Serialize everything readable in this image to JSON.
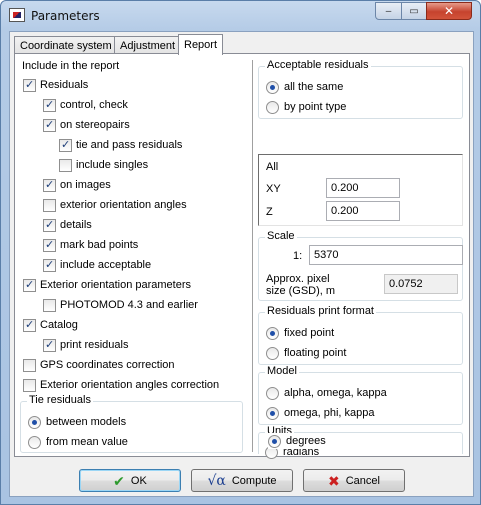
{
  "window": {
    "title": "Parameters",
    "buttons": {
      "minimize": "–",
      "maximize": "▭",
      "close": "✕"
    }
  },
  "tabs": [
    "Coordinate system",
    "Adjustment",
    "Report"
  ],
  "active_tab": "Report",
  "left": {
    "include_label": "Include in the report",
    "checks": [
      {
        "label": "Residuals",
        "checked": true
      },
      {
        "label": "control, check",
        "checked": true
      },
      {
        "label": "on stereopairs",
        "checked": true
      },
      {
        "label": "tie and pass residuals",
        "checked": true
      },
      {
        "label": "include singles",
        "checked": false
      },
      {
        "label": "on images",
        "checked": true
      },
      {
        "label": "exterior orientation angles",
        "checked": false
      },
      {
        "label": "details",
        "checked": true
      },
      {
        "label": "mark bad points",
        "checked": true
      },
      {
        "label": "include acceptable",
        "checked": true
      },
      {
        "label": "Exterior orientation parameters",
        "checked": true
      },
      {
        "label": "PHOTOMOD 4.3 and earlier",
        "checked": false
      },
      {
        "label": "Catalog",
        "checked": true
      },
      {
        "label": "print residuals",
        "checked": true
      },
      {
        "label": "GPS coordinates correction",
        "checked": false
      },
      {
        "label": "Exterior orientation angles correction",
        "checked": false
      }
    ],
    "tie_residuals": {
      "title": "Tie residuals",
      "options": [
        {
          "label": "between models",
          "checked": true
        },
        {
          "label": "from mean value",
          "checked": false
        }
      ]
    }
  },
  "right": {
    "acceptable": {
      "title": "Acceptable residuals",
      "options": [
        {
          "label": "all the same",
          "checked": true
        },
        {
          "label": "by point type",
          "checked": false
        }
      ]
    },
    "all_panel": {
      "title": "All",
      "xy_label": "XY",
      "xy_value": "0.200",
      "z_label": "Z",
      "z_value": "0.200"
    },
    "scale": {
      "title": "Scale",
      "prefix": "1:",
      "value": "5370",
      "gsd_label_1": "Approx. pixel",
      "gsd_label_2": "size (GSD), m",
      "gsd_value": "0.0752"
    },
    "print_format": {
      "title": "Residuals print format",
      "options": [
        {
          "label": "fixed point",
          "checked": true
        },
        {
          "label": "floating point",
          "checked": false
        }
      ]
    },
    "model": {
      "title": "Model",
      "options": [
        {
          "label": "alpha, omega, kappa",
          "checked": false
        },
        {
          "label": "omega, phi, kappa",
          "checked": true
        }
      ]
    },
    "units": {
      "title": "Units",
      "options": [
        {
          "label": "radians",
          "checked": false
        },
        {
          "label": "degrees",
          "checked": true
        }
      ]
    }
  },
  "footer": {
    "ok": "OK",
    "compute": "Compute",
    "cancel": "Cancel",
    "ok_icon": "✔",
    "compute_icon": "√α",
    "cancel_icon": "✖"
  }
}
